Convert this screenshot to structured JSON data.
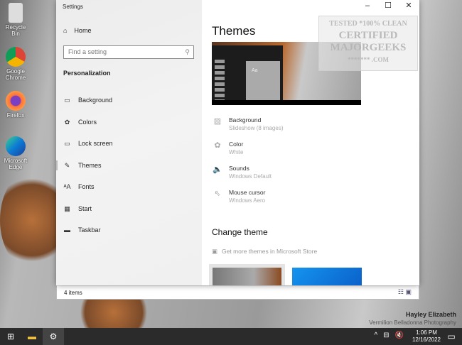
{
  "desktop": {
    "icons": [
      {
        "label": "Recycle Bin"
      },
      {
        "label": "Google Chrome"
      },
      {
        "label": "Firefox"
      },
      {
        "label": "Microsoft Edge"
      }
    ],
    "credit_name": "Hayley Elizabeth",
    "credit_sub": "Vermilion Belladonna Photography"
  },
  "explorer": {
    "status": "4 items"
  },
  "settings": {
    "title": "Settings",
    "home": "Home",
    "search_placeholder": "Find a setting",
    "section": "Personalization",
    "nav": [
      {
        "label": "Background",
        "icon": "picture-icon"
      },
      {
        "label": "Colors",
        "icon": "palette-icon"
      },
      {
        "label": "Lock screen",
        "icon": "lock-screen-icon"
      },
      {
        "label": "Themes",
        "icon": "brush-icon",
        "selected": true
      },
      {
        "label": "Fonts",
        "icon": "fonts-icon"
      },
      {
        "label": "Start",
        "icon": "start-icon"
      },
      {
        "label": "Taskbar",
        "icon": "taskbar-icon"
      }
    ],
    "page_title": "Themes",
    "preview_tile": "Aa",
    "props": [
      {
        "title": "Background",
        "value": "Slideshow (8 images)"
      },
      {
        "title": "Color",
        "value": "White"
      },
      {
        "title": "Sounds",
        "value": "Windows Default"
      },
      {
        "title": "Mouse cursor",
        "value": "Windows Aero"
      }
    ],
    "change_theme": "Change theme",
    "store_link": "Get more themes in Microsoft Store"
  },
  "watermark": {
    "line1": "TESTED *100% CLEAN",
    "line2": "CERTIFIED",
    "line3": "MAJORGEEKS",
    "line4": "******* .COM"
  },
  "taskbar": {
    "time": "1:06 PM",
    "date": "12/16/2022"
  }
}
